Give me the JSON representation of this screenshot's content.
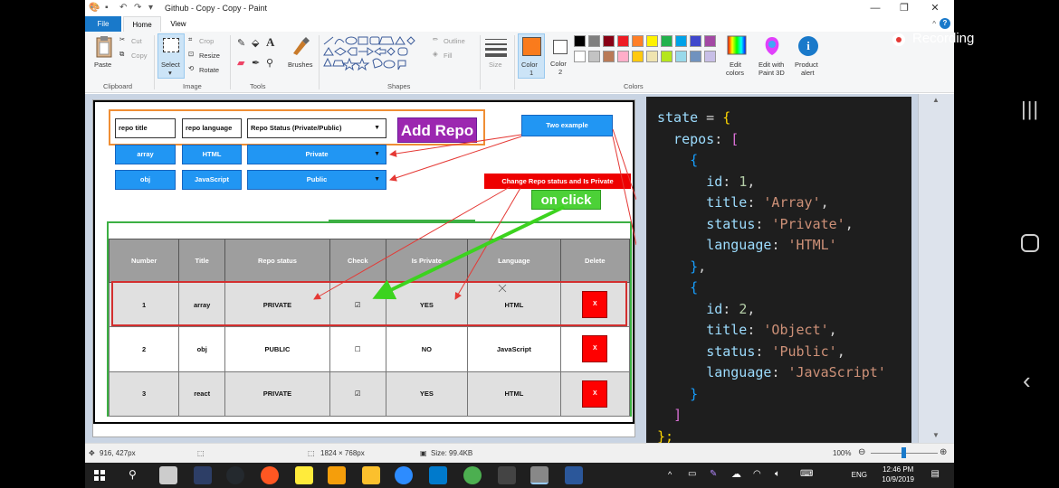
{
  "window": {
    "title": "Github - Copy - Copy - Paint",
    "tabs": [
      "File",
      "Home",
      "View"
    ]
  },
  "ribbon": {
    "clipboard": {
      "paste": "Paste",
      "cut": "Cut",
      "copy": "Copy",
      "label": "Clipboard"
    },
    "image": {
      "select": "Select",
      "crop": "Crop",
      "resize": "Resize",
      "rotate": "Rotate",
      "label": "Image"
    },
    "tools": {
      "label": "Tools",
      "brushes": "Brushes"
    },
    "shapes": {
      "outline": "Outline",
      "fill": "Fill",
      "label": "Shapes"
    },
    "size": {
      "label": "Size"
    },
    "colors": {
      "color1": "Color",
      "color1_num": "1",
      "color2": "Color",
      "color2_num": "2",
      "edit": "Edit",
      "edit2": "colors",
      "paint3d": "Edit with",
      "paint3d2": "Paint 3D",
      "product": "Product",
      "product2": "alert",
      "label": "Colors",
      "color1_value": "#fa7b1c",
      "palette_row1": [
        "#000000",
        "#7f7f7f",
        "#880015",
        "#ed1c24",
        "#ff7f27",
        "#fff200",
        "#22b14c",
        "#00a2e8",
        "#3f48cc",
        "#a349a4"
      ],
      "palette_row2": [
        "#ffffff",
        "#c3c3c3",
        "#b97a57",
        "#ffaec9",
        "#ffc90e",
        "#efe4b0",
        "#b5e61d",
        "#99d9ea",
        "#7092be",
        "#c8bfe7"
      ]
    }
  },
  "recording": {
    "label": "Recording"
  },
  "diagram": {
    "inputs": {
      "title": "repo title",
      "language": "repo language",
      "status": "Repo Status (Private/Public)"
    },
    "add_repo": "Add Repo",
    "two_example": "Two example",
    "change_status": "Change Repo status and Is Private",
    "on_click": "on click",
    "examples": [
      {
        "title": "array",
        "language": "HTML",
        "status": "Private"
      },
      {
        "title": "obj",
        "language": "JavaScript",
        "status": "Public"
      }
    ],
    "table": {
      "headers": [
        "Number",
        "Title",
        "Repo status",
        "Check",
        "Is Private",
        "Language",
        "Delete"
      ],
      "rows": [
        {
          "number": "1",
          "title": "array",
          "status": "PRIVATE",
          "check": "☑",
          "private": "YES",
          "language": "HTML",
          "delete": "X"
        },
        {
          "number": "2",
          "title": "obj",
          "status": "PUBLIC",
          "check": "☐",
          "private": "NO",
          "language": "JavaScript",
          "delete": "X"
        },
        {
          "number": "3",
          "title": "react",
          "status": "PRIVATE",
          "check": "☑",
          "private": "YES",
          "language": "HTML",
          "delete": "X"
        }
      ]
    }
  },
  "code": {
    "l1a": "state",
    "l1b": " = ",
    "l1c": "{",
    "l2a": "  repos",
    "l2b": ": ",
    "l2c": "[",
    "open": "{",
    "close": "}",
    "comma": ",",
    "id": "id",
    "title": "title",
    "status": "status",
    "language": "language",
    "r1": {
      "id": "1",
      "title": "'Array'",
      "status": "'Private'",
      "language": "'HTML'"
    },
    "r2": {
      "id": "2",
      "title": "'Object'",
      "status": "'Public'",
      "language": "'JavaScript'"
    },
    "end_bracket": "]",
    "end_brace": "};"
  },
  "status": {
    "cursor": "916, 427px",
    "dimensions": "1824 × 768px",
    "size": "Size: 99.4KB",
    "zoom": "100%"
  },
  "taskbar": {
    "time": "12:46 PM",
    "date": "10/9/2019",
    "lang": "ENG"
  }
}
